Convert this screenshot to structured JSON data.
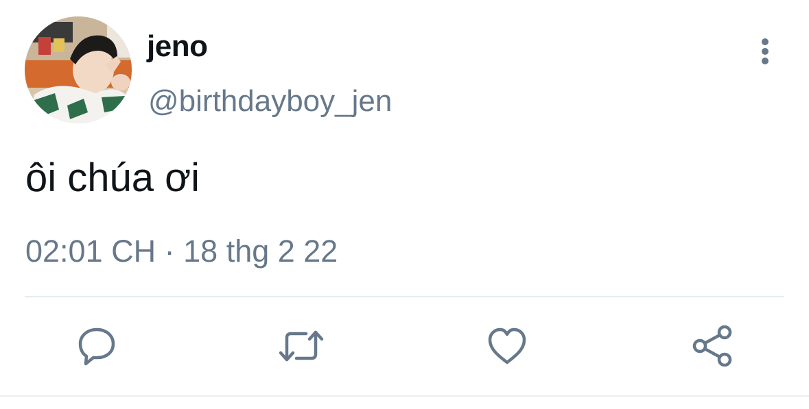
{
  "tweet": {
    "display_name": "jeno",
    "handle": "@birthdayboy_jen",
    "text": "ôi chúa ơi",
    "time": "02:01 CH",
    "separator": "·",
    "date": "18 thg 2 22"
  },
  "icons": {
    "more": "more-vertical-icon",
    "reply": "reply-icon",
    "retweet": "retweet-icon",
    "like": "heart-icon",
    "share": "share-icon"
  },
  "colors": {
    "text_primary": "#0f1419",
    "text_secondary": "#66788a",
    "icon": "#66788a",
    "divider": "#e6ecf0"
  }
}
